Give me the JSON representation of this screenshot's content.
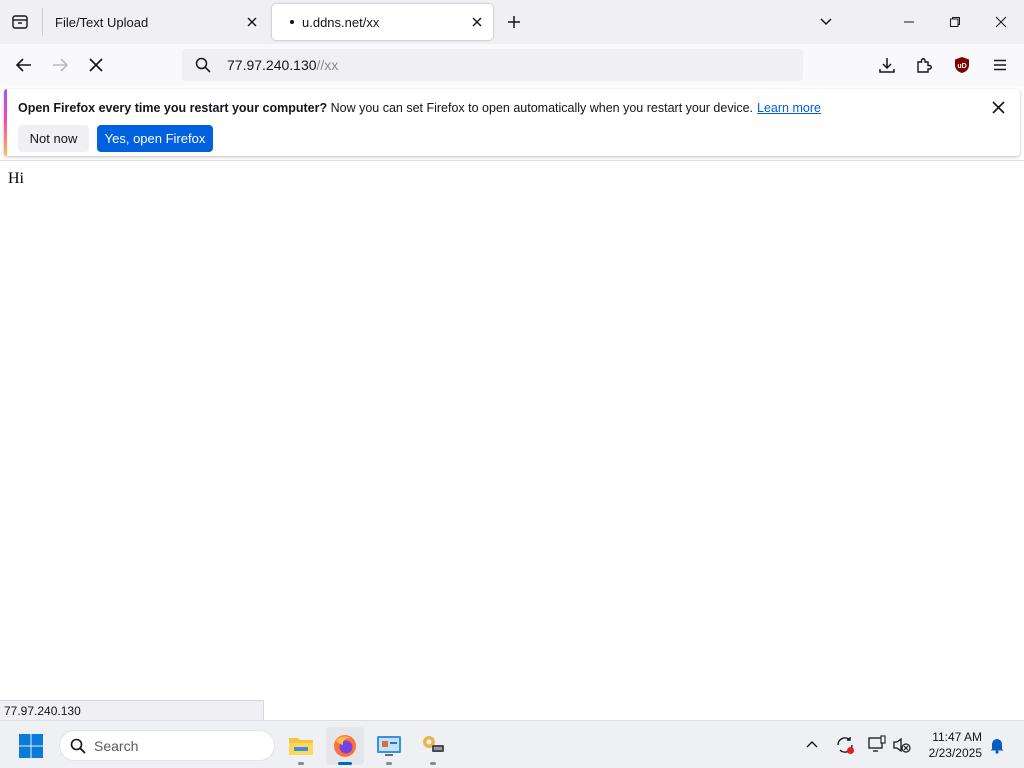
{
  "tabs": [
    {
      "label": "File/Text Upload"
    },
    {
      "label": "u.ddns.net/xx"
    }
  ],
  "urlbar": {
    "host": "77.97.240.130",
    "path": "//xx"
  },
  "notification": {
    "bold": "Open Firefox every time you restart your computer?",
    "text": " Now you can set Firefox to open automatically when you restart your device.",
    "link": "Learn more",
    "secondary_button": "Not now",
    "primary_button": "Yes, open Firefox"
  },
  "page": {
    "body_text": "Hi"
  },
  "status_bar": {
    "text": "77.97.240.130"
  },
  "taskbar": {
    "search_placeholder": "Search",
    "time": "11:47 AM",
    "date": "2/23/2025"
  },
  "colors": {
    "accent": "#0061e0",
    "tab_strip": "#f0f0f4"
  }
}
